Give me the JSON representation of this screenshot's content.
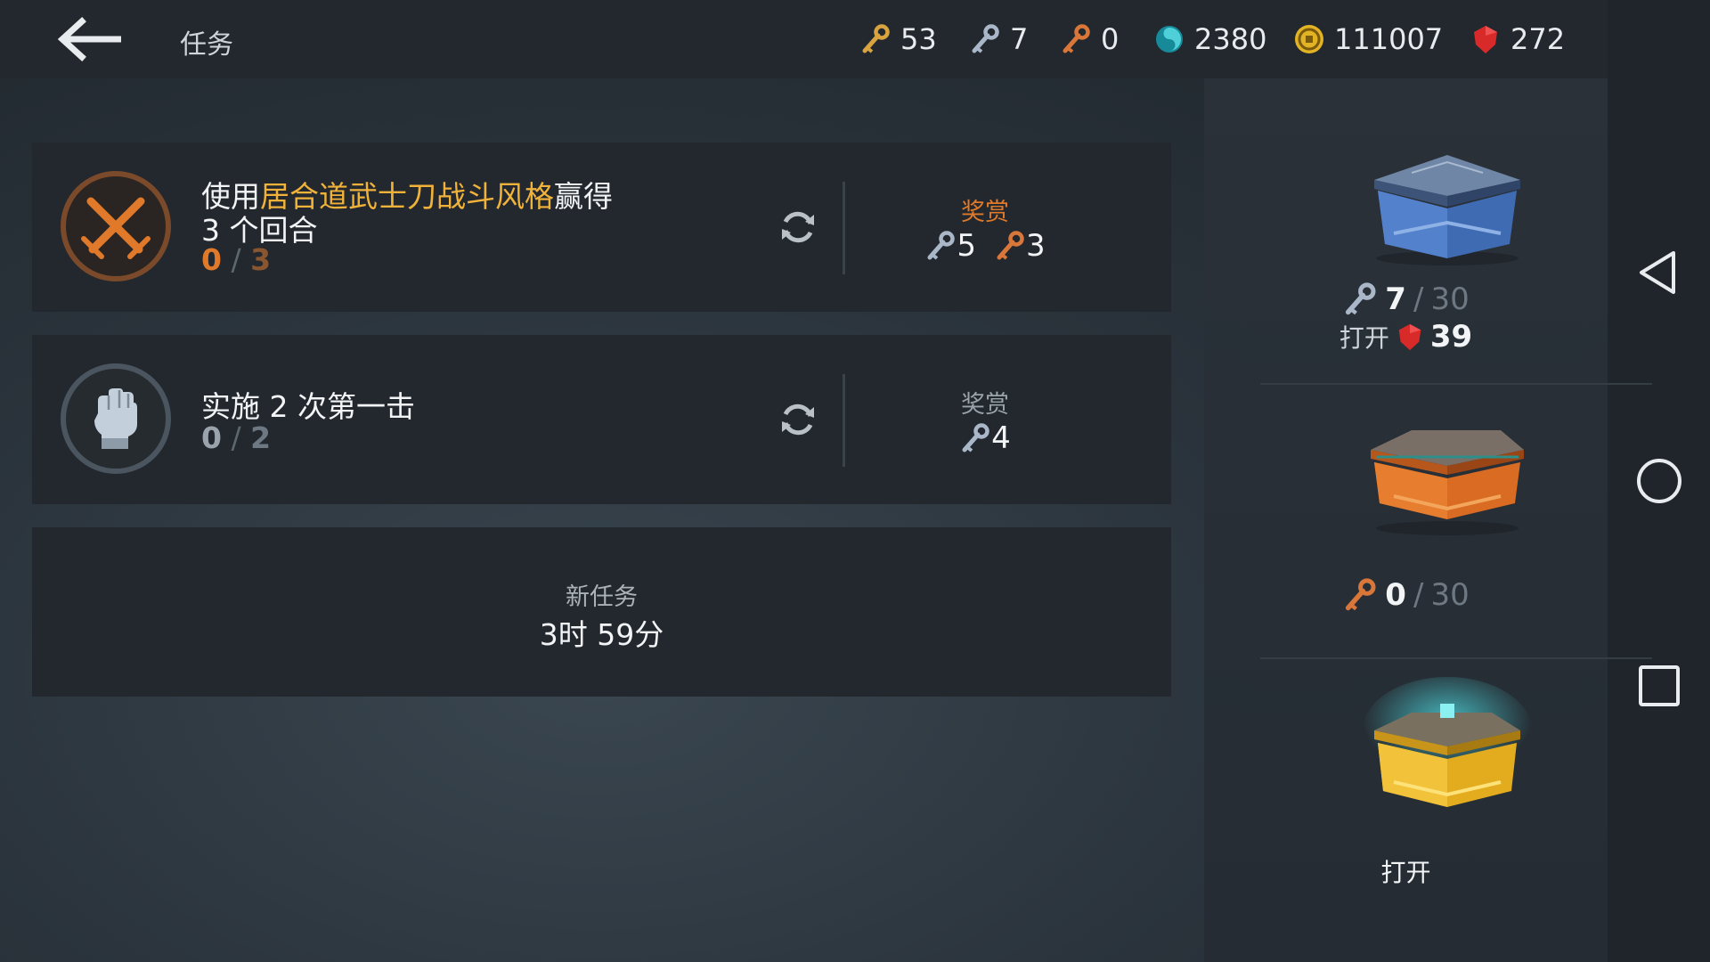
{
  "header": {
    "title": "任务",
    "currencies": {
      "gold_keys": "53",
      "silver_keys": "7",
      "bronze_keys": "0",
      "orbs": "2380",
      "coins": "111007",
      "gems": "272"
    }
  },
  "quests": [
    {
      "text_prefix": "使用",
      "text_highlight": "居合道武士刀战斗风格",
      "text_suffix": "赢得",
      "text_line2": "3 个回合",
      "progress_current": "0",
      "progress_sep": "/",
      "progress_total": "3",
      "reward_label": "奖赏",
      "rewards": [
        {
          "type": "silver-key",
          "amount": "5"
        },
        {
          "type": "bronze-key",
          "amount": "3"
        }
      ]
    },
    {
      "text_line1": "实施 2 次第一击",
      "progress_current": "0",
      "progress_sep": "/",
      "progress_total": "2",
      "reward_label": "奖赏",
      "rewards": [
        {
          "type": "silver-key",
          "amount": "4"
        }
      ]
    }
  ],
  "new_quest": {
    "label": "新任务",
    "time": "3时 59分"
  },
  "chests": [
    {
      "key_type": "silver-key",
      "current": "7",
      "sep": "/",
      "total": "30",
      "open_label": "打开",
      "gem_cost": "39"
    },
    {
      "key_type": "bronze-key",
      "current": "0",
      "sep": "/",
      "total": "30"
    },
    {
      "open_label": "打开"
    }
  ],
  "colors": {
    "highlight": "#f1b23a",
    "reward_orange": "#e07a2a",
    "reward_gray": "#9aa3ab",
    "progress_orange": "#e07a2a",
    "progress_gray": "#9aa3ab"
  }
}
